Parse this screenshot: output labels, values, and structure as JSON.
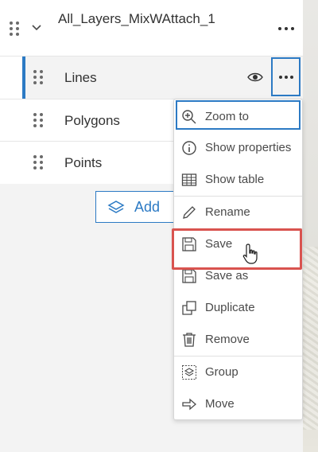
{
  "group_layer": {
    "title": "All_Layers_MixWAttach_1"
  },
  "layers": [
    {
      "label": "Lines"
    },
    {
      "label": "Polygons"
    },
    {
      "label": "Points"
    }
  ],
  "add_button": {
    "label": "Add"
  },
  "context_menu": {
    "items": [
      {
        "label": "Zoom to",
        "icon": "zoom-in-icon"
      },
      {
        "label": "Show properties",
        "icon": "info-icon"
      },
      {
        "label": "Show table",
        "icon": "table-icon"
      },
      {
        "label": "Rename",
        "icon": "pencil-icon"
      },
      {
        "label": "Save",
        "icon": "save-icon"
      },
      {
        "label": "Save as",
        "icon": "save-as-icon"
      },
      {
        "label": "Duplicate",
        "icon": "duplicate-icon"
      },
      {
        "label": "Remove",
        "icon": "trash-icon"
      },
      {
        "label": "Group",
        "icon": "group-icon"
      },
      {
        "label": "Move",
        "icon": "move-arrow-icon"
      }
    ]
  },
  "colors": {
    "accent": "#2c7ac4",
    "highlight": "#d9534f"
  }
}
